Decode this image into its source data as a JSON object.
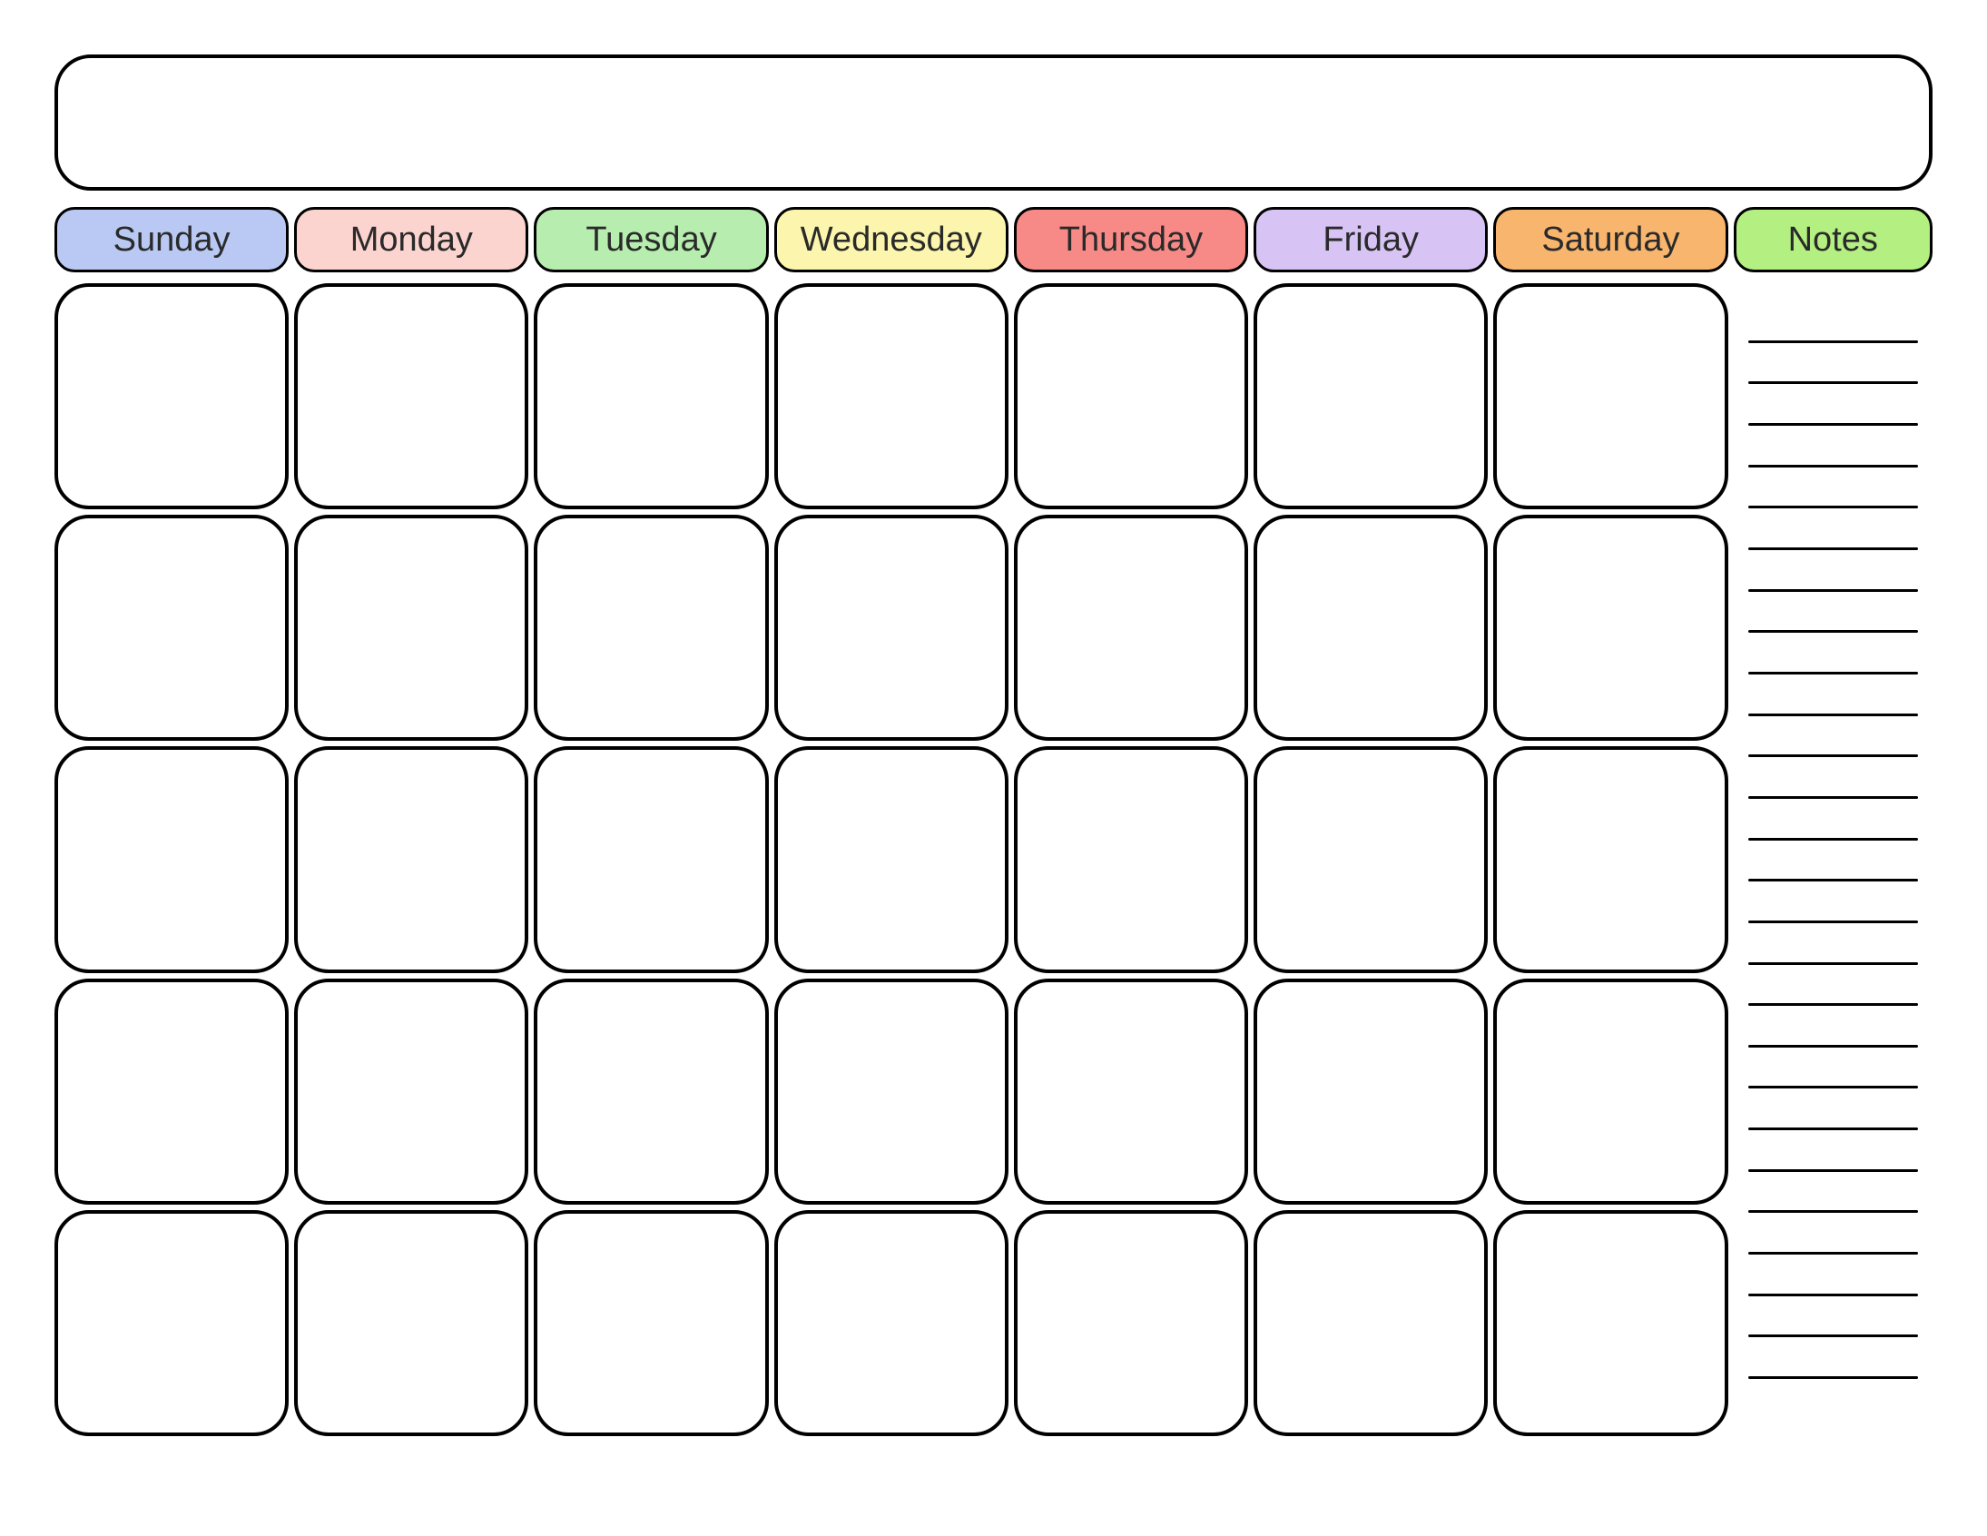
{
  "title": "",
  "headers": {
    "sunday": "Sunday",
    "monday": "Monday",
    "tuesday": "Tuesday",
    "wednesday": "Wednesday",
    "thursday": "Thursday",
    "friday": "Friday",
    "saturday": "Saturday",
    "notes": "Notes"
  },
  "colors": {
    "sunday": "#b9c9f3",
    "monday": "#fcd4cf",
    "tuesday": "#b7eeb0",
    "wednesday": "#fbf5ad",
    "thursday": "#f78a86",
    "friday": "#d7c4f5",
    "saturday": "#f8b56d",
    "notes": "#b4ef81"
  },
  "grid": {
    "rows": 5,
    "cols": 7,
    "cells": [
      [
        "",
        "",
        "",
        "",
        "",
        "",
        ""
      ],
      [
        "",
        "",
        "",
        "",
        "",
        "",
        ""
      ],
      [
        "",
        "",
        "",
        "",
        "",
        "",
        ""
      ],
      [
        "",
        "",
        "",
        "",
        "",
        "",
        ""
      ],
      [
        "",
        "",
        "",
        "",
        "",
        "",
        ""
      ]
    ]
  },
  "notes_lines": 26
}
